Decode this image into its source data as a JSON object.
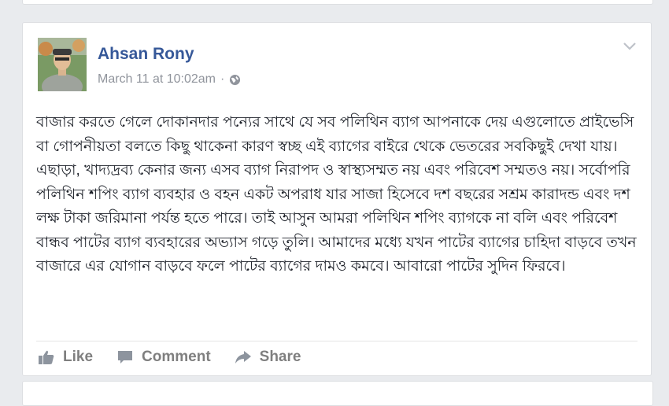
{
  "post": {
    "author": "Ahsan Rony",
    "timestamp": "March 11 at 10:02am",
    "separator": "·",
    "privacy_icon": "globe-icon",
    "body": "বাজার করতে গেলে দোকানদার পন্যের সাথে যে সব পলিথিন ব্যাগ আপনাকে দেয় এগুলোতে প্রাইভেসি বা গোপনীয়তা বলতে কিছু থাকেনা কারণ স্বচ্ছ এই ব্যাগের বাইরে থেকে ভেতরের সবকিছুই দেখা যায়। এছাড়া, খাদ্যদ্রব্য কেনার জন্য এসব ব্যাগ নিরাপদ ও স্বাস্থ্যসম্মত নয় এবং পরিবেশ সম্মতও নয়। সর্বোপরি পলিথিন শপিং ব্যাগ ব্যবহার ও বহন একট অপরাধ যার সাজা হিসেবে দশ বছরের সশ্রম কারাদন্ড এবং দশ লক্ষ টাকা জরিমানা পর্যন্ত হতে পারে। তাই আসুন আমরা পলিথিন শপিং ব্যাগকে না বলি এবং পরিবেশ বান্ধব পাটের ব্যাগ ব্যবহারের অভ্যাস গড়ে তুলি। আমাদের মধ্যে যখন পাটের ব্যাগের চাহিদা বাড়বে তখন বাজারে এর যোগান বাড়বে ফলে পাটের ব্যাগের দামও কমবে। আবারো পাটের সুদিন ফিরবে।"
  },
  "actions": {
    "like": "Like",
    "comment": "Comment",
    "share": "Share"
  },
  "colors": {
    "author_link": "#365899",
    "meta_text": "#90949c",
    "action_text": "#7f7f7f",
    "page_bg": "#e9ebee"
  }
}
